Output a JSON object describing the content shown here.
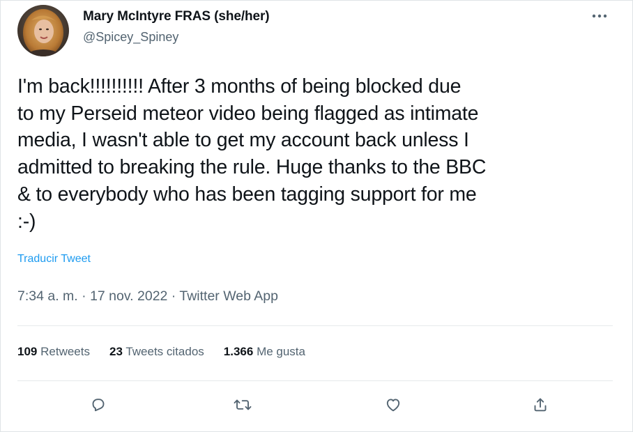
{
  "author": {
    "display_name": "Mary McIntyre FRAS (she/her)",
    "handle": "@Spicey_Spiney",
    "avatar_icon": "profile-photo"
  },
  "more_icon": "more-horizontal-icon",
  "tweet": {
    "text": "I'm back!!!!!!!!!! After 3 months of being blocked due\nto my Perseid meteor video being flagged as intimate\nmedia, I wasn't able to get my account back unless I\nadmitted to breaking the  rule. Huge thanks to the BBC\n& to everybody who has been tagging support for me\n:-)",
    "translate_label": "Traducir Tweet",
    "time": "7:34 a. m.",
    "separator": " · ",
    "date": "17 nov. 2022",
    "source": "Twitter Web App"
  },
  "stats": {
    "retweets_count": "109",
    "retweets_label": "Retweets",
    "quotes_count": "23",
    "quotes_label": "Tweets citados",
    "likes_count": "1.366",
    "likes_label": "Me gusta"
  },
  "actions": [
    {
      "icon": "reply-icon"
    },
    {
      "icon": "retweet-icon"
    },
    {
      "icon": "like-icon"
    },
    {
      "icon": "share-icon"
    }
  ],
  "colors": {
    "text": "#0f1419",
    "secondary": "#536471",
    "link": "#1d9bf0",
    "divider": "#e6e9eb"
  }
}
